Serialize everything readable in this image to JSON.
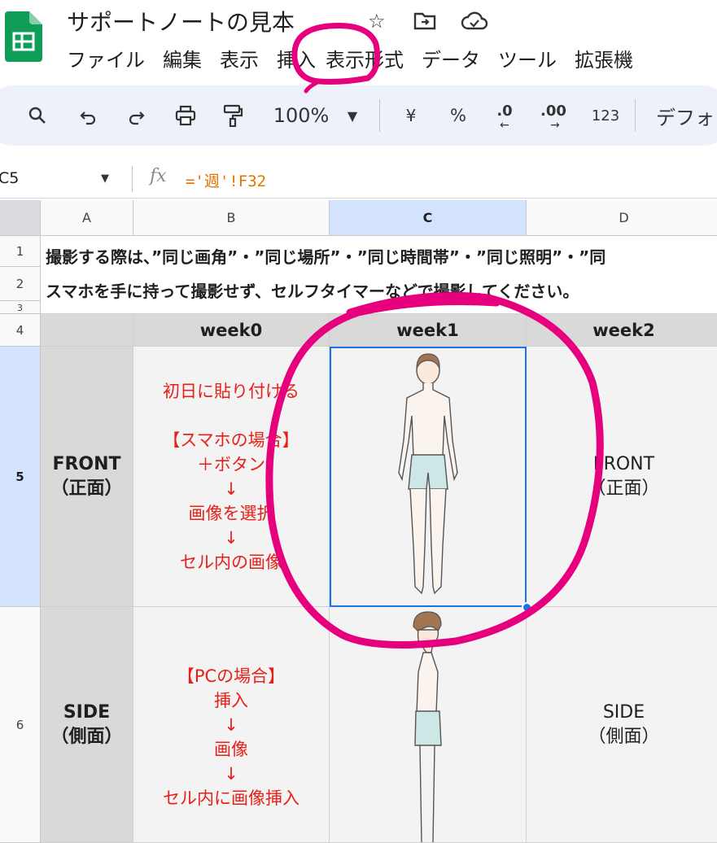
{
  "app": {
    "title": "サポートノートの見本",
    "brand_color": "#0f9d58",
    "title_icons": [
      "star-icon",
      "move-to-folder-icon",
      "cloud-saved-icon"
    ]
  },
  "menu": [
    "ファイル",
    "編集",
    "表示",
    "挿入",
    "表示形式",
    "データ",
    "ツール",
    "拡張機"
  ],
  "toolbar": {
    "zoom": "100%",
    "currency": "¥",
    "percent": "%",
    "decimal_decrease": ".0",
    "decimal_increase": ".00",
    "number_format": "123",
    "font": "デフォ"
  },
  "formula_bar": {
    "cell_ref": "C5",
    "fx": "fx",
    "formula": "='週'!F32"
  },
  "columns": [
    "A",
    "B",
    "C",
    "D"
  ],
  "rows": [
    "1",
    "2",
    "3",
    "4",
    "5",
    "6"
  ],
  "sheet": {
    "note_line1": "撮影する際は、”同じ画角”・”同じ場所”・”同じ時間帯”・”同じ照明”・”同",
    "note_line2": "スマホを手に持って撮影せず、セルフタイマーなどで撮影してください。",
    "headers": [
      "week0",
      "week1",
      "week2"
    ],
    "front_label": [
      "FRONT",
      "（正面）"
    ],
    "side_label": [
      "SIDE",
      "（側面）"
    ],
    "b5_lines": [
      "初日に貼り付ける",
      "",
      "【スマホの場合】",
      "＋ボタン",
      "↓",
      "画像を選択",
      "↓",
      "セル内の画像"
    ],
    "b6_lines": [
      "【PCの場合】",
      "挿入",
      "↓",
      "画像",
      "↓",
      "セル内に画像挿入"
    ],
    "d5_lines": [
      "FRONT",
      "（正面）"
    ],
    "d6_lines": [
      "SIDE",
      "（側面）"
    ]
  },
  "colors": {
    "accent": "#1a73e8",
    "annotation": "#e6007e",
    "instruction_red": "#e8201a",
    "header_gray": "#d9d9d9",
    "formula_orange": "#e37400"
  }
}
